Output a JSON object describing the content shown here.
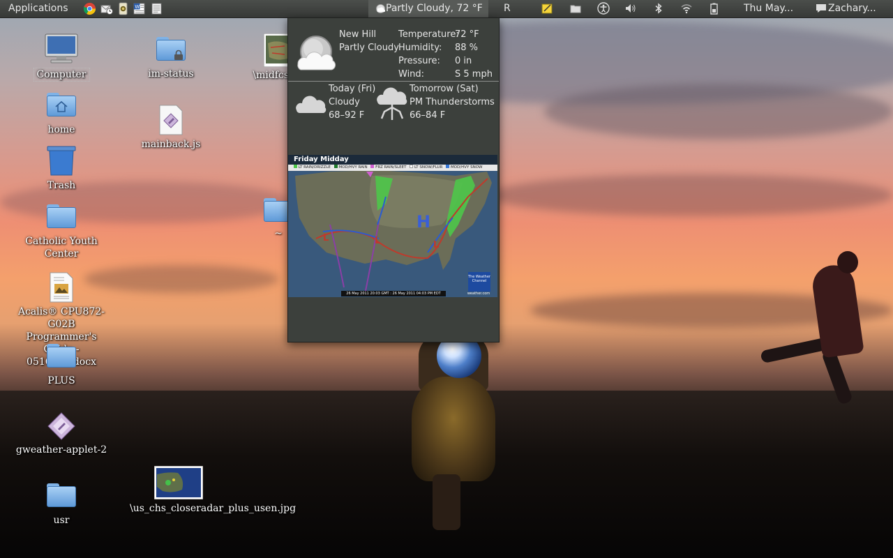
{
  "panel": {
    "applications": "Applications",
    "weather": "Partly Cloudy, 72 °F",
    "keyboard": "R",
    "clock": "Thu May...",
    "user": "Zachary..."
  },
  "desktop": {
    "icons": [
      {
        "label": "Computer"
      },
      {
        "label": "home"
      },
      {
        "label": "Trash"
      },
      {
        "label": "Catholic Youth Center"
      },
      {
        "label": "Acalis® CPU872-G02B Programmer's Guide - 0516111.docx"
      },
      {
        "label": "PLUS"
      },
      {
        "label": "gweather-applet-2"
      },
      {
        "label": "usr"
      },
      {
        "label": "im-status"
      },
      {
        "label": "mainback.js"
      },
      {
        "label": "\\midfcst_6"
      },
      {
        "label": "~"
      },
      {
        "label": "\\us_chs_closeradar_plus_usen.jpg"
      }
    ]
  },
  "weather": {
    "location": "New Hill",
    "condition": "Partly Cloudy",
    "temperature_label": "Temperature:",
    "temperature": "72 °F",
    "humidity_label": "Humidity:",
    "humidity": "88 %",
    "pressure_label": "Pressure:",
    "pressure": "0 in",
    "wind_label": "Wind:",
    "wind": "S 5 mph",
    "today": {
      "title": "Today (Fri)",
      "condition": "Cloudy",
      "range": "68–92 F"
    },
    "tomorrow": {
      "title": "Tomorrow (Sat)",
      "condition": "PM Thunderstorms",
      "range": "66–84 F"
    },
    "map": {
      "title": "Friday Midday",
      "legend": [
        "LT RAIN/DRIZZLE",
        "MOD/HVY RAIN",
        "FRZ RAIN/SLEET",
        "LT SNOW/FLUR",
        "MOD/HVY SNOW"
      ],
      "footer": "26 May 2011 20:03 GMT : 26 May 2011 04:03 PM EDT",
      "brand": "The Weather Channel",
      "site": "weather.com",
      "high": "H",
      "low": "L"
    }
  }
}
